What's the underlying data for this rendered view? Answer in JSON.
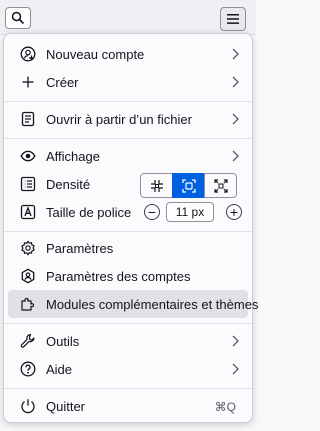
{
  "toolbar": {
    "search_icon": "search-icon",
    "menu_icon": "hamburger-menu-icon"
  },
  "menu": {
    "new_account": "Nouveau compte",
    "create": "Créer",
    "open_file": "Ouvrir à partir d’un fichier",
    "view": "Affichage",
    "density": "Densité",
    "font_size": "Taille de police",
    "font_size_value": "11 px",
    "font_minus": "−",
    "font_plus": "+",
    "settings": "Paramètres",
    "account_settings": "Paramètres des comptes",
    "addons": "Modules complémentaires et thèmes",
    "tools": "Outils",
    "help": "Aide",
    "quit": "Quitter",
    "quit_shortcut": "⌘Q"
  },
  "density": {
    "options": [
      "compact",
      "normal",
      "relaxed"
    ],
    "selected": "normal"
  },
  "colors": {
    "accent": "#0061e0",
    "highlight": "#e0e0e6",
    "text": "#15141a"
  }
}
